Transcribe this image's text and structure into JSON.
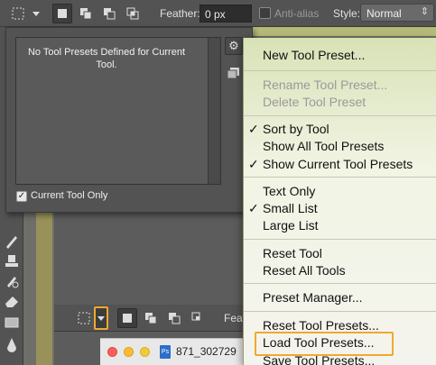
{
  "options_bar": {
    "feather_label": "Feather:",
    "feather_value": "0 px",
    "anti_alias_label": "Anti-alias",
    "style_label": "Style:",
    "style_value": "Normal"
  },
  "preset_panel": {
    "empty_message": "No Tool Presets Defined for Current Tool.",
    "current_tool_only_label": "Current Tool Only",
    "current_tool_only_checked": true
  },
  "bottom_bar": {
    "feather_label": "Feat"
  },
  "document": {
    "title": "871_302729"
  },
  "menu": {
    "items": [
      {
        "label": "New Tool Preset...",
        "enabled": true,
        "checked": false
      },
      {
        "label": "Rename Tool Preset...",
        "enabled": false,
        "checked": false
      },
      {
        "label": "Delete Tool Preset",
        "enabled": false,
        "checked": false
      },
      {
        "label": "Sort by Tool",
        "enabled": true,
        "checked": true
      },
      {
        "label": "Show All Tool Presets",
        "enabled": true,
        "checked": false
      },
      {
        "label": "Show Current Tool Presets",
        "enabled": true,
        "checked": true
      },
      {
        "label": "Text Only",
        "enabled": true,
        "checked": false
      },
      {
        "label": "Small List",
        "enabled": true,
        "checked": true
      },
      {
        "label": "Large List",
        "enabled": true,
        "checked": false
      },
      {
        "label": "Reset Tool",
        "enabled": true,
        "checked": false
      },
      {
        "label": "Reset All Tools",
        "enabled": true,
        "checked": false
      },
      {
        "label": "Preset Manager...",
        "enabled": true,
        "checked": false
      },
      {
        "label": "Reset Tool Presets...",
        "enabled": true,
        "checked": false
      },
      {
        "label": "Load Tool Presets...",
        "enabled": true,
        "checked": false
      },
      {
        "label": "Save Tool Presets...",
        "enabled": true,
        "checked": false
      }
    ],
    "check_glyph": "✓"
  },
  "colors": {
    "highlight": "#f0a830",
    "panel": "#535353",
    "menu_top": "#d8e2b6"
  }
}
